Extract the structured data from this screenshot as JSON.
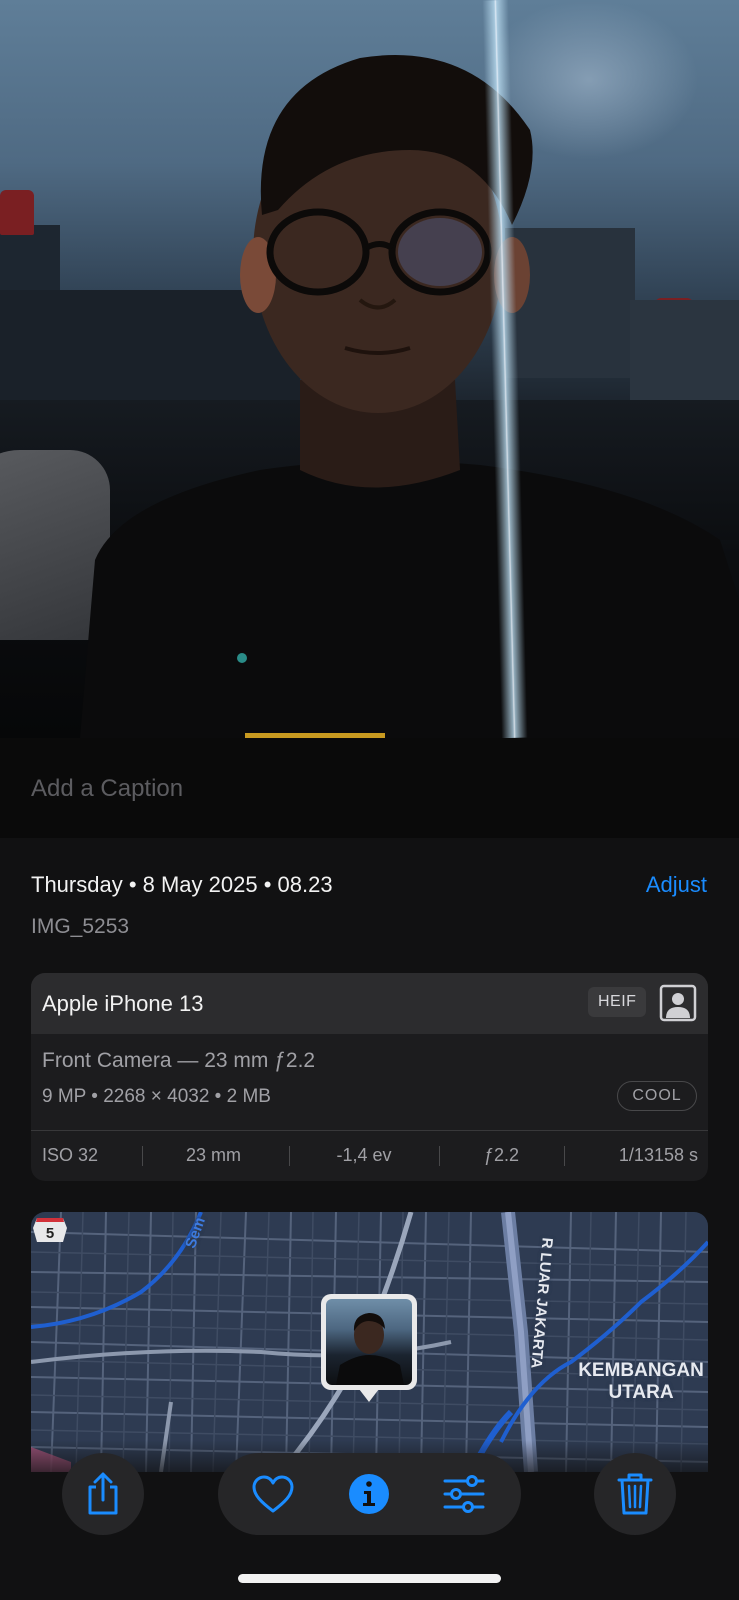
{
  "caption": {
    "placeholder": "Add a Caption"
  },
  "header": {
    "date": "Thursday • 8 May 2025 • 08.23",
    "adjust_label": "Adjust",
    "filename": "IMG_5253"
  },
  "camera_card": {
    "device": "Apple iPhone 13",
    "format_badge": "HEIF",
    "lens": "Front Camera — 23 mm ƒ2.2",
    "specs": "9 MP  •  2268 × 4032  •  2 MB",
    "style_badge": "COOL",
    "exif": [
      "ISO 32",
      "23 mm",
      "-1,4 ev",
      "ƒ2.2",
      "1/13158 s"
    ]
  },
  "map": {
    "area_label_line1": "KEMBANGAN",
    "area_label_line2": "UTARA",
    "road_label": "R LUAR JAKARTA",
    "street_label": "Sem",
    "route_number": "5"
  },
  "toolbar": {
    "share_icon": "share-icon",
    "favorite_icon": "heart-icon",
    "info_icon": "info-icon",
    "adjust_icon": "sliders-icon",
    "delete_icon": "trash-icon"
  },
  "colors": {
    "accent": "#1a8cff",
    "background": "#111112",
    "card": "#1c1c1e"
  }
}
